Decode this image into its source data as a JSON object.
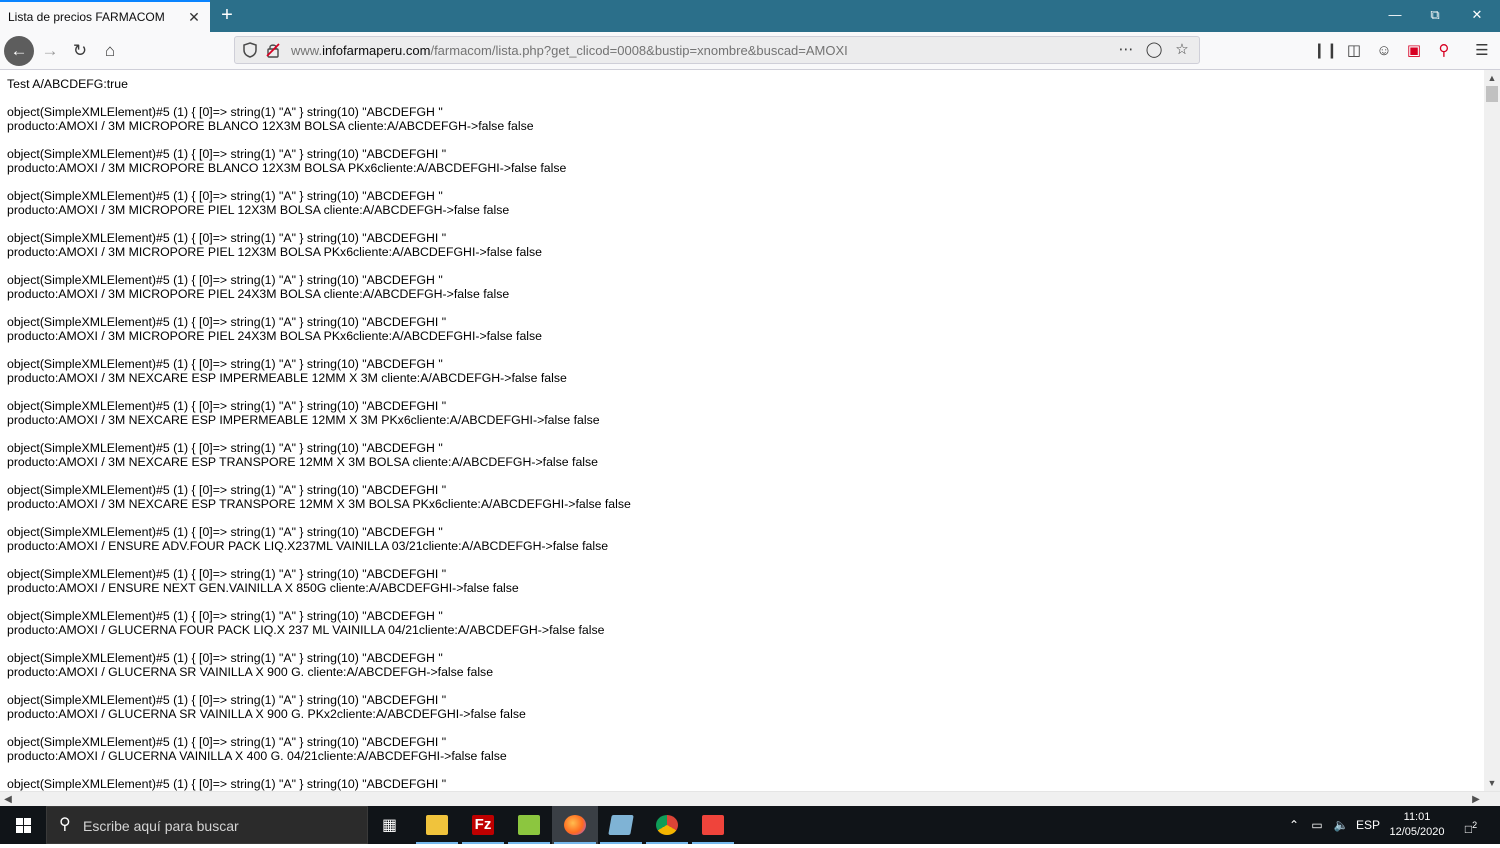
{
  "browser": {
    "tab_title": "Lista de precios FARMACOM",
    "tab_close": "✕",
    "new_tab": "+",
    "url_prefix": "www.",
    "url_domain": "infofarmaperu.com",
    "url_path": "/farmacom/lista.php?get_clicod=0008&bustip=xnombre&buscad=AMOXI"
  },
  "content": {
    "header_line": "Test A/ABCDEFG:true",
    "entries": [
      {
        "obj": "object(SimpleXMLElement)#5 (1) { [0]=> string(1) \"A\" } string(10) \"ABCDEFGH \"",
        "prod": "producto:AMOXI / 3M MICROPORE BLANCO 12X3M BOLSA cliente:A/ABCDEFGH->false false"
      },
      {
        "obj": "object(SimpleXMLElement)#5 (1) { [0]=> string(1) \"A\" } string(10) \"ABCDEFGHI \"",
        "prod": "producto:AMOXI / 3M MICROPORE BLANCO 12X3M BOLSA PKx6cliente:A/ABCDEFGHI->false false"
      },
      {
        "obj": "object(SimpleXMLElement)#5 (1) { [0]=> string(1) \"A\" } string(10) \"ABCDEFGH \"",
        "prod": "producto:AMOXI / 3M MICROPORE PIEL 12X3M BOLSA cliente:A/ABCDEFGH->false false"
      },
      {
        "obj": "object(SimpleXMLElement)#5 (1) { [0]=> string(1) \"A\" } string(10) \"ABCDEFGHI \"",
        "prod": "producto:AMOXI / 3M MICROPORE PIEL 12X3M BOLSA PKx6cliente:A/ABCDEFGHI->false false"
      },
      {
        "obj": "object(SimpleXMLElement)#5 (1) { [0]=> string(1) \"A\" } string(10) \"ABCDEFGH \"",
        "prod": "producto:AMOXI / 3M MICROPORE PIEL 24X3M BOLSA cliente:A/ABCDEFGH->false false"
      },
      {
        "obj": "object(SimpleXMLElement)#5 (1) { [0]=> string(1) \"A\" } string(10) \"ABCDEFGHI \"",
        "prod": "producto:AMOXI / 3M MICROPORE PIEL 24X3M BOLSA PKx6cliente:A/ABCDEFGHI->false false"
      },
      {
        "obj": "object(SimpleXMLElement)#5 (1) { [0]=> string(1) \"A\" } string(10) \"ABCDEFGH \"",
        "prod": "producto:AMOXI / 3M NEXCARE ESP IMPERMEABLE 12MM X 3M cliente:A/ABCDEFGH->false false"
      },
      {
        "obj": "object(SimpleXMLElement)#5 (1) { [0]=> string(1) \"A\" } string(10) \"ABCDEFGHI \"",
        "prod": "producto:AMOXI / 3M NEXCARE ESP IMPERMEABLE 12MM X 3M PKx6cliente:A/ABCDEFGHI->false false"
      },
      {
        "obj": "object(SimpleXMLElement)#5 (1) { [0]=> string(1) \"A\" } string(10) \"ABCDEFGH \"",
        "prod": "producto:AMOXI / 3M NEXCARE ESP TRANSPORE 12MM X 3M BOLSA cliente:A/ABCDEFGH->false false"
      },
      {
        "obj": "object(SimpleXMLElement)#5 (1) { [0]=> string(1) \"A\" } string(10) \"ABCDEFGHI \"",
        "prod": "producto:AMOXI / 3M NEXCARE ESP TRANSPORE 12MM X 3M BOLSA PKx6cliente:A/ABCDEFGHI->false false"
      },
      {
        "obj": "object(SimpleXMLElement)#5 (1) { [0]=> string(1) \"A\" } string(10) \"ABCDEFGH \"",
        "prod": "producto:AMOXI / ENSURE ADV.FOUR PACK LIQ.X237ML VAINILLA 03/21cliente:A/ABCDEFGH->false false"
      },
      {
        "obj": "object(SimpleXMLElement)#5 (1) { [0]=> string(1) \"A\" } string(10) \"ABCDEFGHI \"",
        "prod": "producto:AMOXI / ENSURE NEXT GEN.VAINILLA X 850G cliente:A/ABCDEFGHI->false false"
      },
      {
        "obj": "object(SimpleXMLElement)#5 (1) { [0]=> string(1) \"A\" } string(10) \"ABCDEFGH \"",
        "prod": "producto:AMOXI / GLUCERNA FOUR PACK LIQ.X 237 ML VAINILLA 04/21cliente:A/ABCDEFGH->false false"
      },
      {
        "obj": "object(SimpleXMLElement)#5 (1) { [0]=> string(1) \"A\" } string(10) \"ABCDEFGH \"",
        "prod": "producto:AMOXI / GLUCERNA SR VAINILLA X 900 G. cliente:A/ABCDEFGH->false false"
      },
      {
        "obj": "object(SimpleXMLElement)#5 (1) { [0]=> string(1) \"A\" } string(10) \"ABCDEFGHI \"",
        "prod": "producto:AMOXI / GLUCERNA SR VAINILLA X 900 G. PKx2cliente:A/ABCDEFGHI->false false"
      },
      {
        "obj": "object(SimpleXMLElement)#5 (1) { [0]=> string(1) \"A\" } string(10) \"ABCDEFGHI \"",
        "prod": "producto:AMOXI / GLUCERNA VAINILLA X 400 G. 04/21cliente:A/ABCDEFGHI->false false"
      },
      {
        "obj": "object(SimpleXMLElement)#5 (1) { [0]=> string(1) \"A\" } string(10) \"ABCDEFGHI \"",
        "prod": ""
      }
    ]
  },
  "taskbar": {
    "search_placeholder": "Escribe aquí para buscar",
    "language": "ESP",
    "time": "11:01",
    "date": "12/05/2020",
    "notification_count": "2"
  },
  "colors": {
    "titlebar": "#2b6f8a",
    "taskbar": "#101418",
    "accent": "#0a84ff"
  }
}
